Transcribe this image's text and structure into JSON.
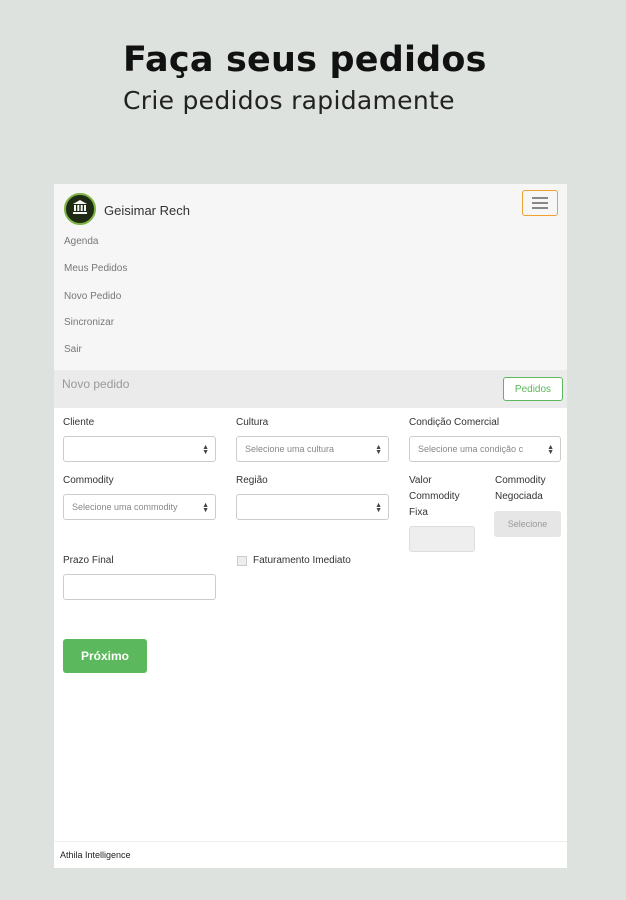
{
  "promo": {
    "title": "Faça seus pedidos",
    "subtitle": "Crie pedidos rapidamente"
  },
  "navbar": {
    "username": "Geisimar Rech",
    "avatar_icon": "bank-icon",
    "menu_icon": "hamburger-menu-icon",
    "links": [
      "Agenda",
      "Meus Pedidos",
      "Novo Pedido",
      "Sincronizar",
      "Sair"
    ]
  },
  "page": {
    "title": "Novo pedido",
    "pedidos_button": "Pedidos"
  },
  "form": {
    "cliente": {
      "label": "Cliente",
      "value": ""
    },
    "cultura": {
      "label": "Cultura",
      "placeholder": "Selecione uma cultura"
    },
    "condicao": {
      "label": "Condição Comercial",
      "placeholder": "Selecione uma condição c"
    },
    "commodity": {
      "label": "Commodity",
      "placeholder": "Selecione uma commodity"
    },
    "regiao": {
      "label": "Região",
      "value": ""
    },
    "valor_fixa": {
      "label": "Valor Commodity Fixa"
    },
    "commodity_negociada": {
      "label": "Commodity Negociada",
      "button": "Selecione"
    },
    "prazo_final": {
      "label": "Prazo Final"
    },
    "faturamento": {
      "label": "Faturamento Imediato"
    },
    "next_button": "Próximo"
  },
  "footer": {
    "text": "Athila Intelligence"
  },
  "colors": {
    "accent_green": "#5cb85c",
    "menu_border": "#f0a030",
    "background": "#dde2de"
  }
}
